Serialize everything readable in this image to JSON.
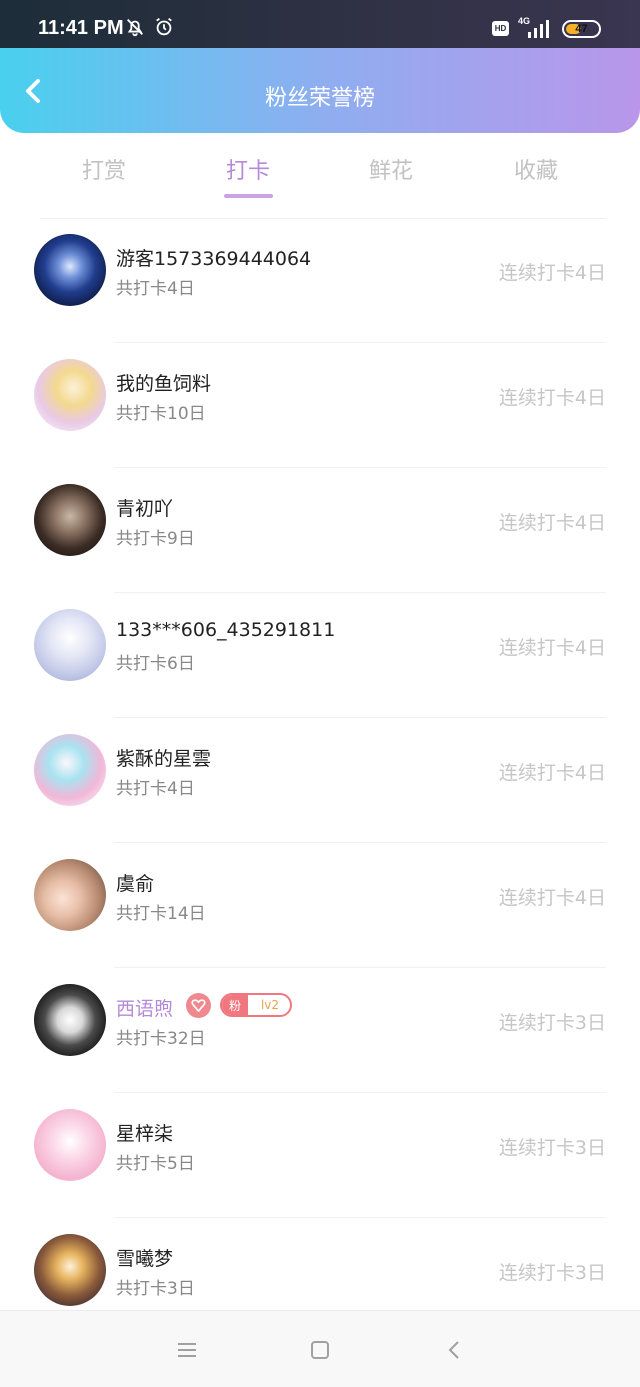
{
  "status_bar": {
    "time": "11:41 PM",
    "icons": [
      "notifications-off-icon",
      "alarm-icon"
    ],
    "hd_label": "HD",
    "network_label": "4G",
    "battery_level": "47",
    "battery_fraction": 0.47
  },
  "header": {
    "title": "粉丝荣誉榜",
    "back_icon": "chevron-left-icon"
  },
  "tabs": [
    {
      "label": "打赏",
      "active": false
    },
    {
      "label": "打卡",
      "active": true
    },
    {
      "label": "鲜花",
      "active": false
    },
    {
      "label": "收藏",
      "active": false
    }
  ],
  "fans": [
    {
      "name": "游客1573369444064",
      "total": "共打卡4日",
      "streak": "连续打卡4日"
    },
    {
      "name": "我的鱼饲料",
      "total": "共打卡10日",
      "streak": "连续打卡4日"
    },
    {
      "name": "青初吖",
      "total": "共打卡9日",
      "streak": "连续打卡4日"
    },
    {
      "name": "133***606_435291811",
      "total": "共打卡6日",
      "streak": "连续打卡4日"
    },
    {
      "name": "紫酥的星雲",
      "total": "共打卡4日",
      "streak": "连续打卡4日"
    },
    {
      "name": "虞俞",
      "total": "共打卡14日",
      "streak": "连续打卡4日"
    },
    {
      "name": "西语煦",
      "total": "共打卡32日",
      "streak": "连续打卡3日",
      "badge_fan_label": "粉",
      "badge_level": "lv2"
    },
    {
      "name": "星梓柒",
      "total": "共打卡5日",
      "streak": "连续打卡3日"
    },
    {
      "name": "雪曦梦",
      "total": "共打卡3日",
      "streak": "连续打卡3日"
    }
  ],
  "nav_bar": {
    "icons": [
      "menu-icon",
      "home-square-icon",
      "back-arrow-icon"
    ]
  },
  "colors": {
    "accent": "#b58ad9",
    "header_gradient_start": "#49d0ef",
    "header_gradient_end": "#b996ea",
    "badge_pink": "#f0777f"
  }
}
